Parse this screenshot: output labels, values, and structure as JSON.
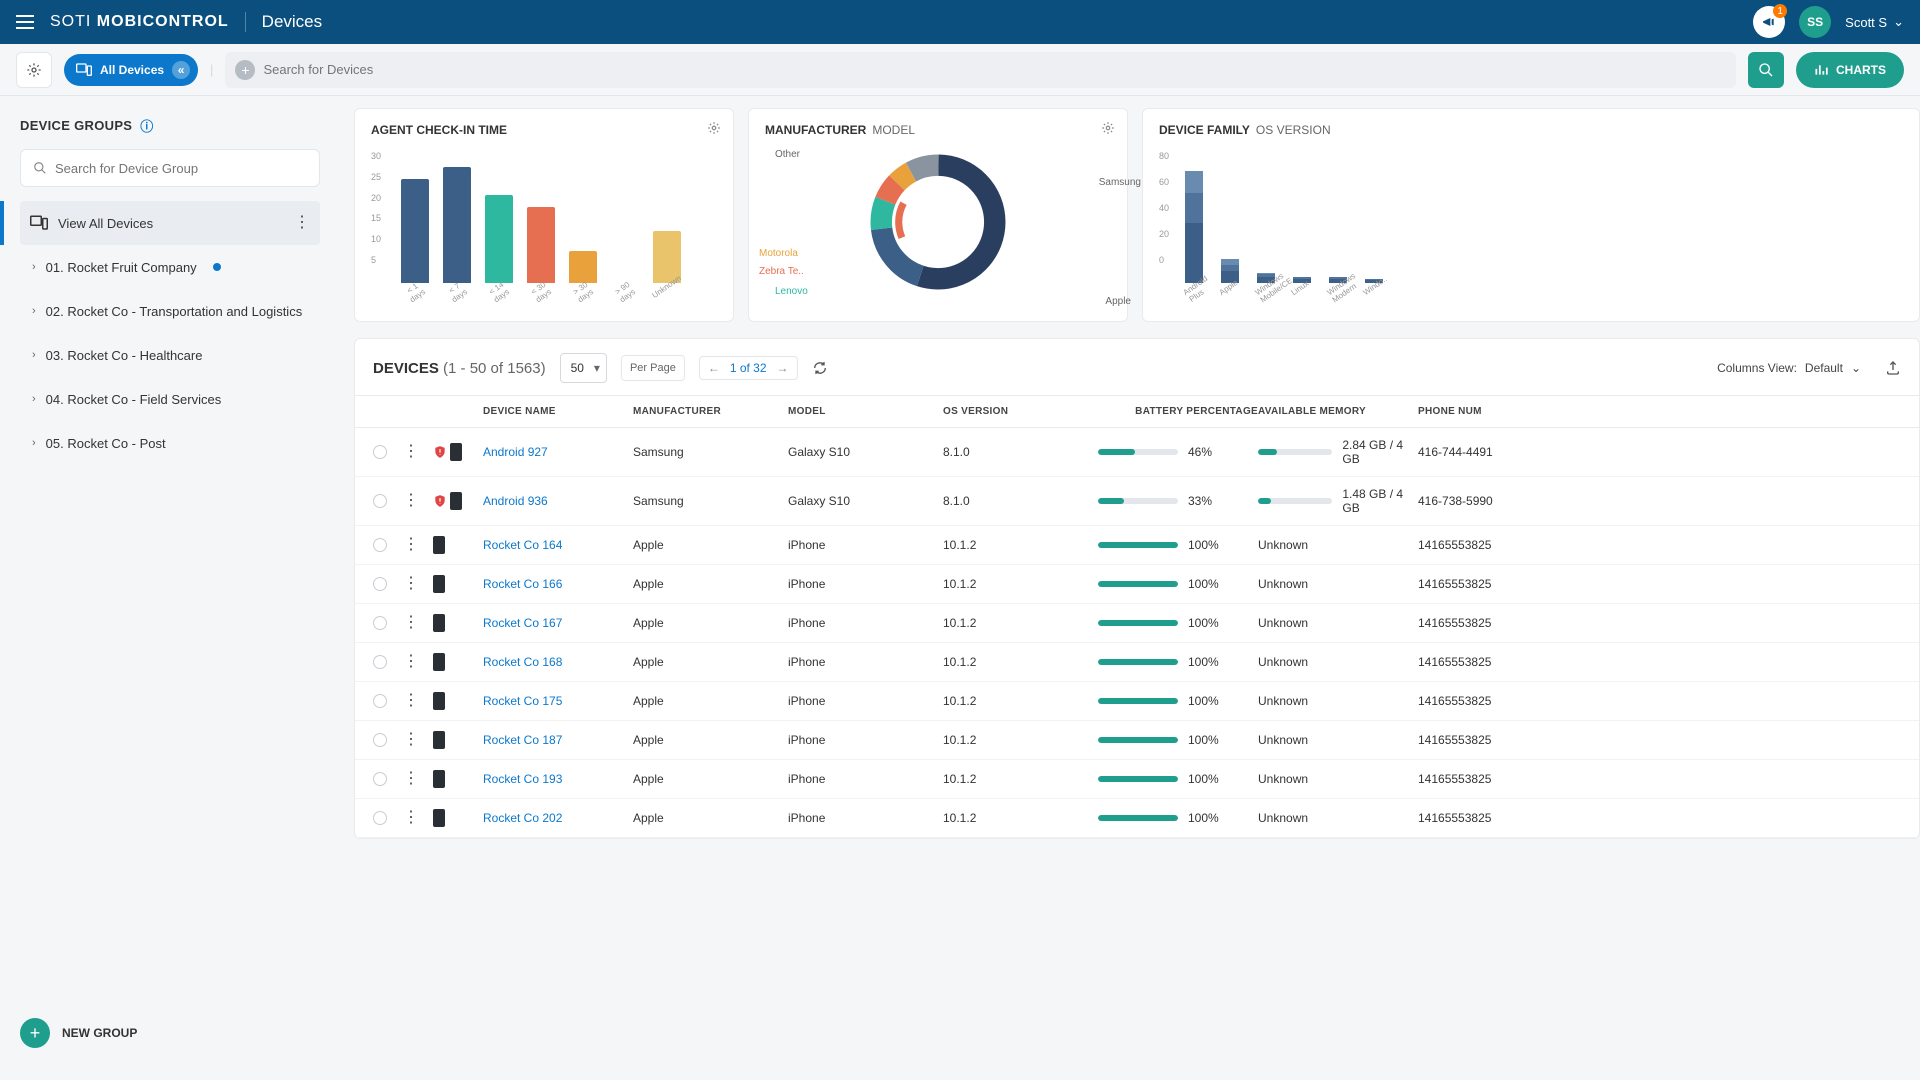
{
  "header": {
    "brand_light": "SOTI",
    "brand_bold": "MOBICONTROL",
    "page": "Devices",
    "notif_count": "1",
    "avatar_initials": "SS",
    "user_name": "Scott S"
  },
  "toolbar": {
    "all_devices": "All Devices",
    "search_placeholder": "Search for Devices",
    "charts": "CHARTS"
  },
  "sidebar": {
    "title": "DEVICE GROUPS",
    "search_placeholder": "Search for Device Group",
    "view_all": "View All Devices",
    "groups": [
      {
        "label": "01. Rocket Fruit Company",
        "dot": true
      },
      {
        "label": "02. Rocket Co - Transportation and Logistics",
        "dot": false
      },
      {
        "label": "03. Rocket Co - Healthcare",
        "dot": false
      },
      {
        "label": "04. Rocket Co - Field Services",
        "dot": false
      },
      {
        "label": "05. Rocket Co - Post",
        "dot": false
      }
    ],
    "new_group": "NEW GROUP"
  },
  "cards": {
    "checkin": {
      "title": "AGENT CHECK-IN TIME"
    },
    "mfr": {
      "title": "MANUFACTURER",
      "sub": "MODEL"
    },
    "family": {
      "title": "DEVICE FAMILY",
      "sub": "OS VERSION"
    }
  },
  "chart_data": [
    {
      "type": "bar",
      "title": "AGENT CHECK-IN TIME",
      "categories": [
        "< 1 days",
        "< 7 days",
        "< 14 days",
        "< 30 days",
        "> 30 days",
        "> 90 days",
        "Unknown"
      ],
      "values": [
        26,
        29,
        22,
        19,
        8,
        0,
        13
      ],
      "colors": [
        "#3b5f87",
        "#3b5f87",
        "#2eb8a0",
        "#e76f51",
        "#e9a23b",
        "#e9a23b",
        "#e9c46a"
      ],
      "ylim": [
        0,
        30
      ],
      "yticks": [
        5,
        10,
        15,
        20,
        25,
        30
      ]
    },
    {
      "type": "pie",
      "title": "MANUFACTURER MODEL",
      "series": [
        {
          "name": "Samsung",
          "value": 55,
          "color": "#2a3f5f"
        },
        {
          "name": "Apple",
          "value": 18,
          "color": "#3b5f87"
        },
        {
          "name": "Lenovo",
          "value": 8,
          "color": "#2eb8a0"
        },
        {
          "name": "Zebra Te..",
          "value": 6,
          "color": "#e76f51"
        },
        {
          "name": "Motorola",
          "value": 5,
          "color": "#e9a23b"
        },
        {
          "name": "Other",
          "value": 8,
          "color": "#8a94a0"
        }
      ]
    },
    {
      "type": "bar",
      "title": "DEVICE FAMILY OS VERSION",
      "categories": [
        "Android Plus",
        "Apple",
        "Windows Mobile/CE",
        "Linux",
        "Windows Modern",
        "Windo.."
      ],
      "series": [
        {
          "name": "seg1",
          "values": [
            40,
            8,
            4,
            3,
            3,
            2
          ],
          "color": "#3b5f87"
        },
        {
          "name": "seg2",
          "values": [
            20,
            4,
            2,
            1,
            1,
            1
          ],
          "color": "#4f739a"
        },
        {
          "name": "seg3",
          "values": [
            15,
            4,
            1,
            0,
            0,
            0
          ],
          "color": "#6a8bb0"
        }
      ],
      "ylim": [
        0,
        80
      ],
      "yticks": [
        0,
        20,
        40,
        60,
        80
      ]
    }
  ],
  "table": {
    "title": "DEVICES",
    "range": "(1 - 50 of 1563)",
    "page_size": "50",
    "per_page": "Per Page",
    "page_of": "1 of 32",
    "cols_label": "Columns View:",
    "cols_value": "Default",
    "headers": {
      "name": "DEVICE NAME",
      "mfr": "MANUFACTURER",
      "model": "MODEL",
      "os": "OS VERSION",
      "batt": "BATTERY PERCENTAGE",
      "mem": "AVAILABLE MEMORY",
      "phone": "PHONE NUM"
    },
    "rows": [
      {
        "name": "Android 927",
        "mfr": "Samsung",
        "model": "Galaxy S10",
        "os": "8.1.0",
        "batt": 46,
        "batt_txt": "46%",
        "mem": 25,
        "mem_txt": "2.84 GB / 4 GB",
        "phone": "416-744-4491",
        "shield": true
      },
      {
        "name": "Android 936",
        "mfr": "Samsung",
        "model": "Galaxy S10",
        "os": "8.1.0",
        "batt": 33,
        "batt_txt": "33%",
        "mem": 18,
        "mem_txt": "1.48 GB / 4 GB",
        "phone": "416-738-5990",
        "shield": true
      },
      {
        "name": "Rocket Co 164",
        "mfr": "Apple",
        "model": "iPhone",
        "os": "10.1.2",
        "batt": 100,
        "batt_txt": "100%",
        "mem": 0,
        "mem_txt": "Unknown",
        "phone": "14165553825",
        "shield": false
      },
      {
        "name": "Rocket Co 166",
        "mfr": "Apple",
        "model": "iPhone",
        "os": "10.1.2",
        "batt": 100,
        "batt_txt": "100%",
        "mem": 0,
        "mem_txt": "Unknown",
        "phone": "14165553825",
        "shield": false
      },
      {
        "name": "Rocket Co 167",
        "mfr": "Apple",
        "model": "iPhone",
        "os": "10.1.2",
        "batt": 100,
        "batt_txt": "100%",
        "mem": 0,
        "mem_txt": "Unknown",
        "phone": "14165553825",
        "shield": false
      },
      {
        "name": "Rocket Co 168",
        "mfr": "Apple",
        "model": "iPhone",
        "os": "10.1.2",
        "batt": 100,
        "batt_txt": "100%",
        "mem": 0,
        "mem_txt": "Unknown",
        "phone": "14165553825",
        "shield": false
      },
      {
        "name": "Rocket Co 175",
        "mfr": "Apple",
        "model": "iPhone",
        "os": "10.1.2",
        "batt": 100,
        "batt_txt": "100%",
        "mem": 0,
        "mem_txt": "Unknown",
        "phone": "14165553825",
        "shield": false
      },
      {
        "name": "Rocket Co 187",
        "mfr": "Apple",
        "model": "iPhone",
        "os": "10.1.2",
        "batt": 100,
        "batt_txt": "100%",
        "mem": 0,
        "mem_txt": "Unknown",
        "phone": "14165553825",
        "shield": false
      },
      {
        "name": "Rocket Co 193",
        "mfr": "Apple",
        "model": "iPhone",
        "os": "10.1.2",
        "batt": 100,
        "batt_txt": "100%",
        "mem": 0,
        "mem_txt": "Unknown",
        "phone": "14165553825",
        "shield": false
      },
      {
        "name": "Rocket Co 202",
        "mfr": "Apple",
        "model": "iPhone",
        "os": "10.1.2",
        "batt": 100,
        "batt_txt": "100%",
        "mem": 0,
        "mem_txt": "Unknown",
        "phone": "14165553825",
        "shield": false
      }
    ]
  },
  "donut_labels": {
    "samsung": "Samsung",
    "apple": "Apple",
    "lenovo": "Lenovo",
    "zebra": "Zebra Te..",
    "motorola": "Motorola",
    "other": "Other"
  }
}
